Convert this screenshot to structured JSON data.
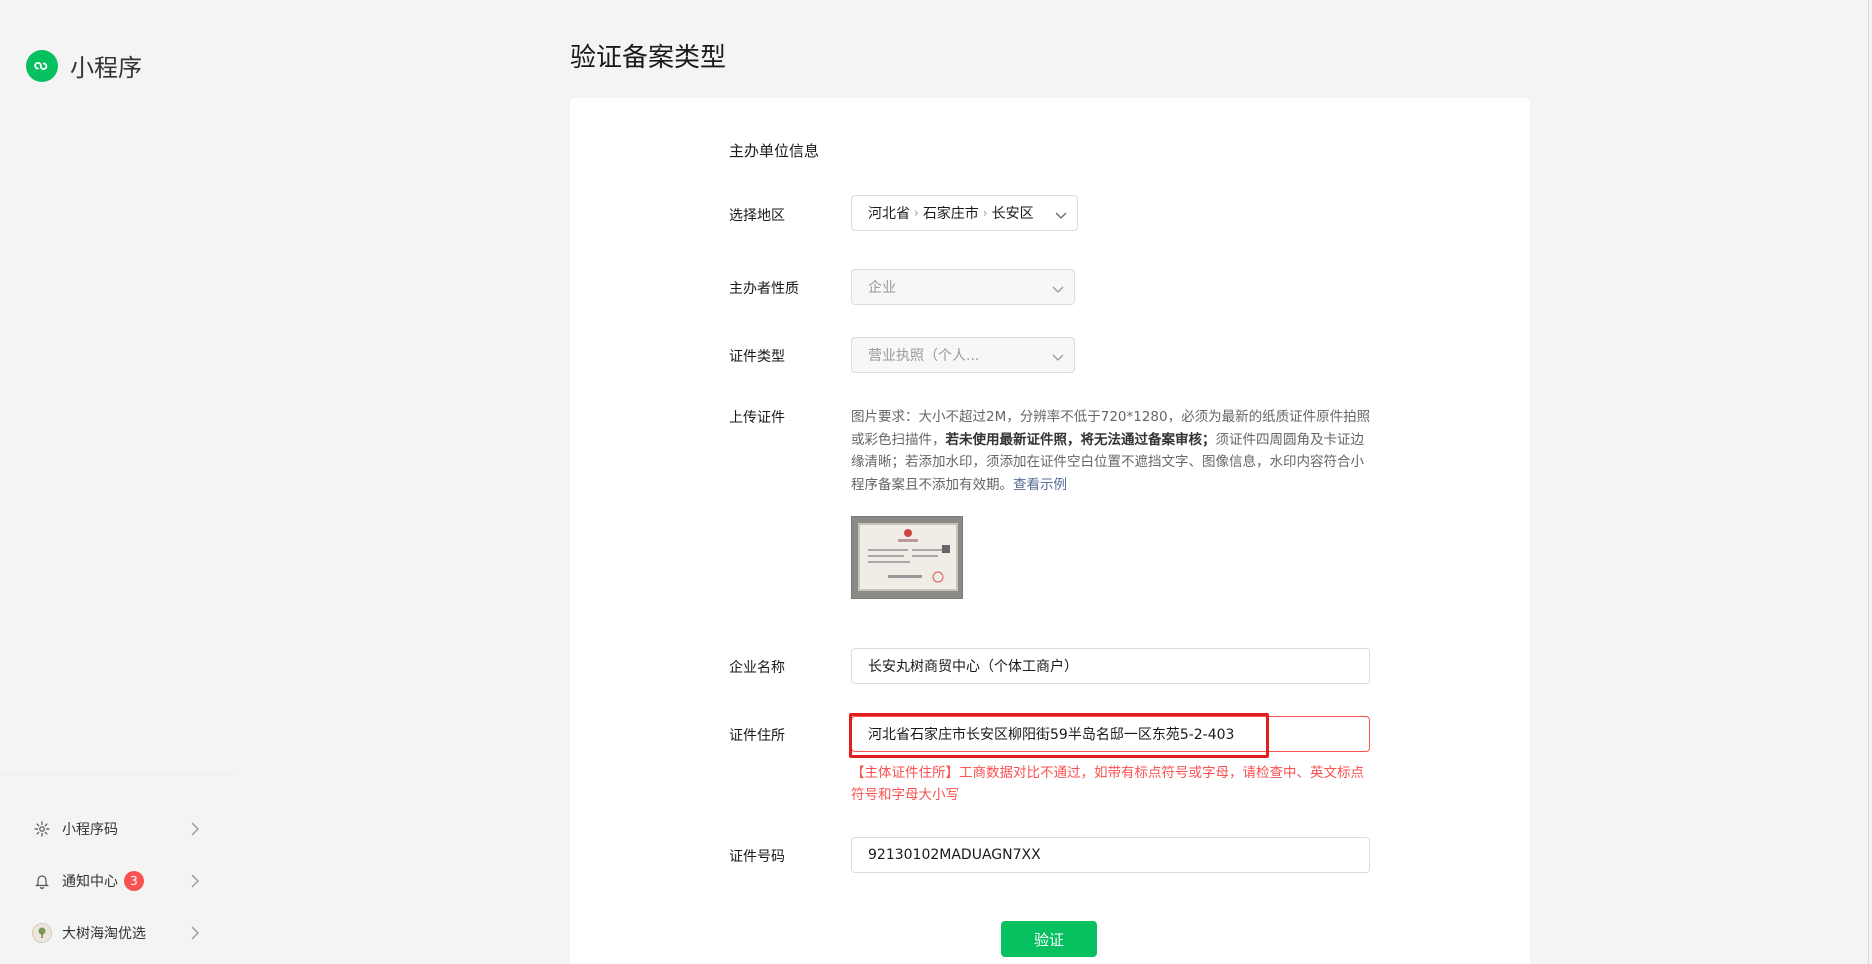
{
  "sidebar": {
    "logo_text": "小程序",
    "bottom_items": [
      {
        "label": "小程序码",
        "icon": "qrcode-sun-icon"
      },
      {
        "label": "通知中心",
        "icon": "bell-icon",
        "badge": "3"
      },
      {
        "label": "大树海淘优选",
        "icon": "account-avatar"
      }
    ]
  },
  "page": {
    "title": "验证备案类型"
  },
  "form": {
    "section_title": "主办单位信息",
    "region": {
      "label": "选择地区",
      "province": "河北省",
      "city": "石家庄市",
      "district": "长安区"
    },
    "organizer_type": {
      "label": "主办者性质",
      "value": "企业"
    },
    "cert_type": {
      "label": "证件类型",
      "value": "营业执照（个人..."
    },
    "upload": {
      "label": "上传证件",
      "hint_part1": "图片要求：大小不超过2M，分辨率不低于720*1280，必须为最新的纸质证件原件拍照或彩色扫描件，",
      "hint_bold": "若未使用最新证件照，将无法通过备案审核；",
      "hint_part2": "须证件四周圆角及卡证边缘清晰；若添加水印，须添加在证件空白位置不遮挡文字、图像信息，水印内容符合小程序备案且不添加有效期。",
      "example_link": "查看示例"
    },
    "company_name": {
      "label": "企业名称",
      "value": "长安丸树商贸中心（个体工商户）"
    },
    "cert_address": {
      "label": "证件住所",
      "value": "河北省石家庄市长安区柳阳街59半岛名邸一区东苑5-2-403",
      "error": "【主体证件住所】工商数据对比不通过，如带有标点符号或字母，请检查中、英文标点符号和字母大小写"
    },
    "cert_number": {
      "label": "证件号码",
      "value": "92130102MADUAGN7XX"
    },
    "verify_label": "验证"
  },
  "colors": {
    "brand_green": "#07c160",
    "error_red": "#fa5151",
    "link_blue": "#576b95"
  }
}
